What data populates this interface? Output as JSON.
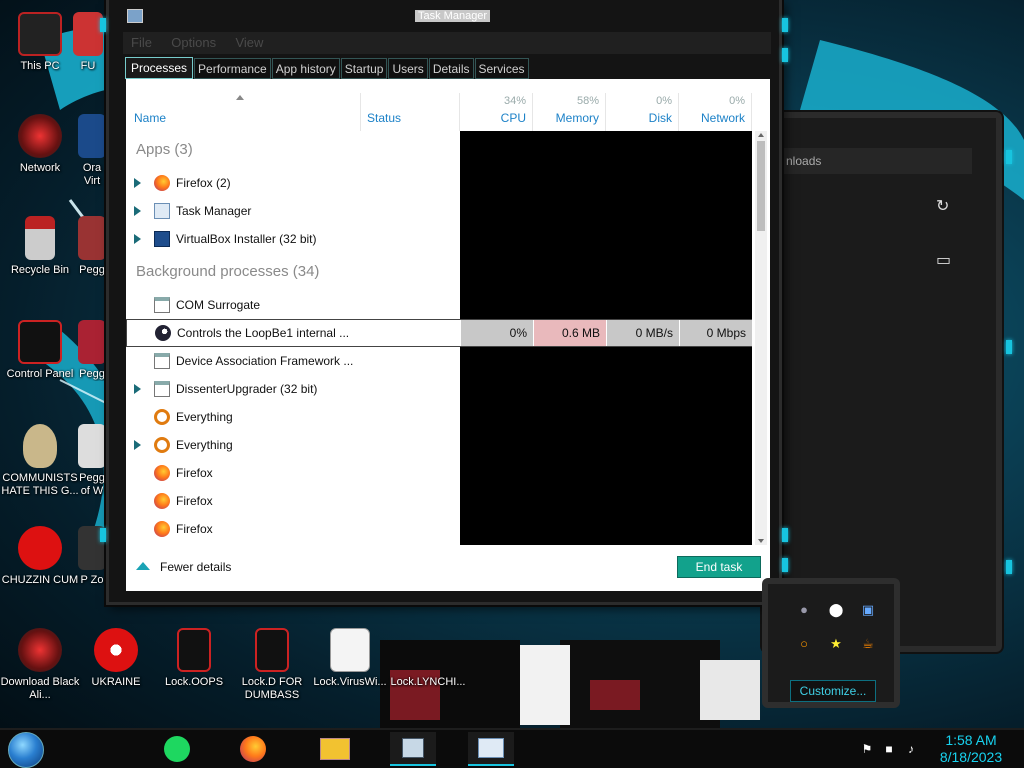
{
  "desktop": {
    "icons": [
      {
        "label": "This PC"
      },
      {
        "label": "FU"
      },
      {
        "label": "Network"
      },
      {
        "label": "Ora Virt"
      },
      {
        "label": "Recycle Bin"
      },
      {
        "label": "Pegg"
      },
      {
        "label": "Control Panel"
      },
      {
        "label": "Pegg"
      },
      {
        "label": "COMMUNISTS HATE THIS G..."
      },
      {
        "label": "Pegg of W"
      },
      {
        "label": "CHUZZIN CUM"
      },
      {
        "label": "P Zo"
      },
      {
        "label": "Download Black Ali..."
      },
      {
        "label": "UKRAINE"
      },
      {
        "label": "Lock.OOPS"
      },
      {
        "label": "Lock.D FOR DUMBASS"
      },
      {
        "label": "Lock.VirusWi..."
      },
      {
        "label": "Lock.LYNCHI..."
      }
    ]
  },
  "bg_window": {
    "address_text": "nloads",
    "refresh_icon": "refresh-icon",
    "folder_icon": "folder-icon"
  },
  "task_manager": {
    "title": "Task Manager",
    "menu": [
      "File",
      "Options",
      "View"
    ],
    "tabs": [
      "Processes",
      "Performance",
      "App history",
      "Startup",
      "Users",
      "Details",
      "Services"
    ],
    "active_tab": "Processes",
    "columns": {
      "name": "Name",
      "status": "Status",
      "cpu": {
        "label": "CPU",
        "pct": "34%"
      },
      "memory": {
        "label": "Memory",
        "pct": "58%"
      },
      "disk": {
        "label": "Disk",
        "pct": "0%"
      },
      "network": {
        "label": "Network",
        "pct": "0%"
      }
    },
    "groups": {
      "apps": "Apps (3)",
      "background": "Background processes (34)"
    },
    "apps": [
      {
        "name": "Firefox (2)",
        "icon": "firefox-icon",
        "expandable": true
      },
      {
        "name": "Task Manager",
        "icon": "task-manager-icon",
        "expandable": true
      },
      {
        "name": "VirtualBox Installer (32 bit)",
        "icon": "virtualbox-icon",
        "expandable": true
      }
    ],
    "background": [
      {
        "name": "COM Surrogate",
        "icon": "window-icon",
        "expandable": false
      },
      {
        "name": "Controls the LoopBe1 internal ...",
        "icon": "loopbe-icon",
        "expandable": false,
        "selected": true,
        "cpu": "0%",
        "memory": "0.6 MB",
        "disk": "0 MB/s",
        "network": "0 Mbps"
      },
      {
        "name": "Device Association Framework ...",
        "icon": "window-icon",
        "expandable": false
      },
      {
        "name": "DissenterUpgrader (32 bit)",
        "icon": "window-icon",
        "expandable": true
      },
      {
        "name": "Everything",
        "icon": "everything-icon",
        "expandable": false
      },
      {
        "name": "Everything",
        "icon": "everything-icon",
        "expandable": true
      },
      {
        "name": "Firefox",
        "icon": "firefox-icon",
        "expandable": false
      },
      {
        "name": "Firefox",
        "icon": "firefox-icon",
        "expandable": false
      },
      {
        "name": "Firefox",
        "icon": "firefox-icon",
        "expandable": false
      }
    ],
    "footer": {
      "fewer_details": "Fewer details",
      "end_task": "End task"
    }
  },
  "tray_flyout": {
    "icons": [
      "loopbe-icon",
      "droplet-icon",
      "monitor-icon",
      "everything-icon",
      "star-icon",
      "java-icon"
    ],
    "customize": "Customize..."
  },
  "taskbar": {
    "pinned": [
      "start-orb-icon",
      "spotify-icon",
      "firefox-icon",
      "file-explorer-icon",
      "network-tool-icon",
      "task-manager-icon"
    ],
    "tray": [
      "flag-icon",
      "network-icon",
      "volume-icon"
    ],
    "time": "1:58 AM",
    "date": "8/18/2023"
  },
  "colors": {
    "accent": "#17c4df",
    "end_task": "#12a28c",
    "memory_highlight": "#e9b9bc",
    "cpu_highlight": "#c8c8c8",
    "column_header": "#1d82c8"
  }
}
